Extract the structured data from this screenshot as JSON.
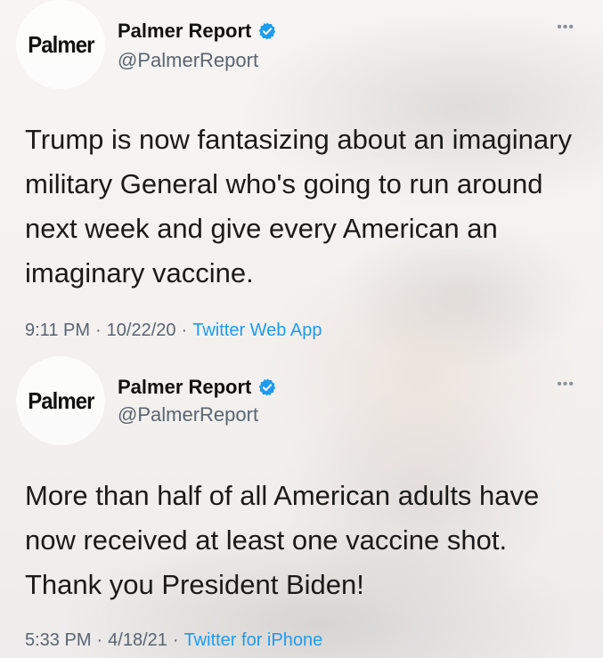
{
  "tweets": [
    {
      "avatar_text": "Palmer",
      "name": "Palmer Report",
      "handle": "@PalmerReport",
      "more": "•••",
      "text": "Trump is now fantasizing about an imaginary military General who's going to run around next week and give every American an imaginary vaccine.",
      "time": "9:11 PM",
      "date": "10/22/20",
      "source": "Twitter Web App"
    },
    {
      "avatar_text": "Palmer",
      "name": "Palmer Report",
      "handle": "@PalmerReport",
      "more": "•••",
      "text": "More than half of all American adults have now received at least one vaccine shot. Thank you President Biden!",
      "time": "5:33 PM",
      "date": "4/18/21",
      "source": "Twitter for iPhone"
    }
  ],
  "separator": "·",
  "colors": {
    "link": "#1d9bf0",
    "verified": "#1d9bf0",
    "secondary_text": "#5b6470"
  }
}
